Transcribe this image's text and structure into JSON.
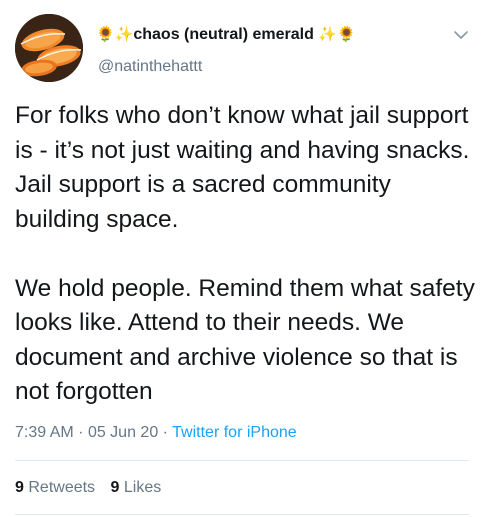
{
  "author": {
    "display_name": "chaos (neutral) emerald",
    "emoji_left": "🌻✨",
    "emoji_right": "✨🌻",
    "username": "@natinthehattt",
    "avatar_icon": "orange-slices-avatar"
  },
  "tweet": {
    "paragraph_1": "For folks who don’t know what jail support is - it’s not just waiting and having snacks. Jail support is a sacred community building space.",
    "paragraph_2": "We hold people. Remind them what safety looks like. Attend to their needs. We document and archive violence so that is not forgotten"
  },
  "meta": {
    "time": "7:39 AM",
    "separator": "·",
    "date": "05 Jun 20",
    "source": "Twitter for iPhone"
  },
  "stats": {
    "retweets_count": "9",
    "retweets_label": "Retweets",
    "likes_count": "9",
    "likes_label": "Likes"
  },
  "colors": {
    "text": "#14171a",
    "secondary": "#657786",
    "link": "#1da1f2",
    "divider": "#e1e8ed"
  },
  "icons": {
    "menu": "chevron-down-icon"
  }
}
